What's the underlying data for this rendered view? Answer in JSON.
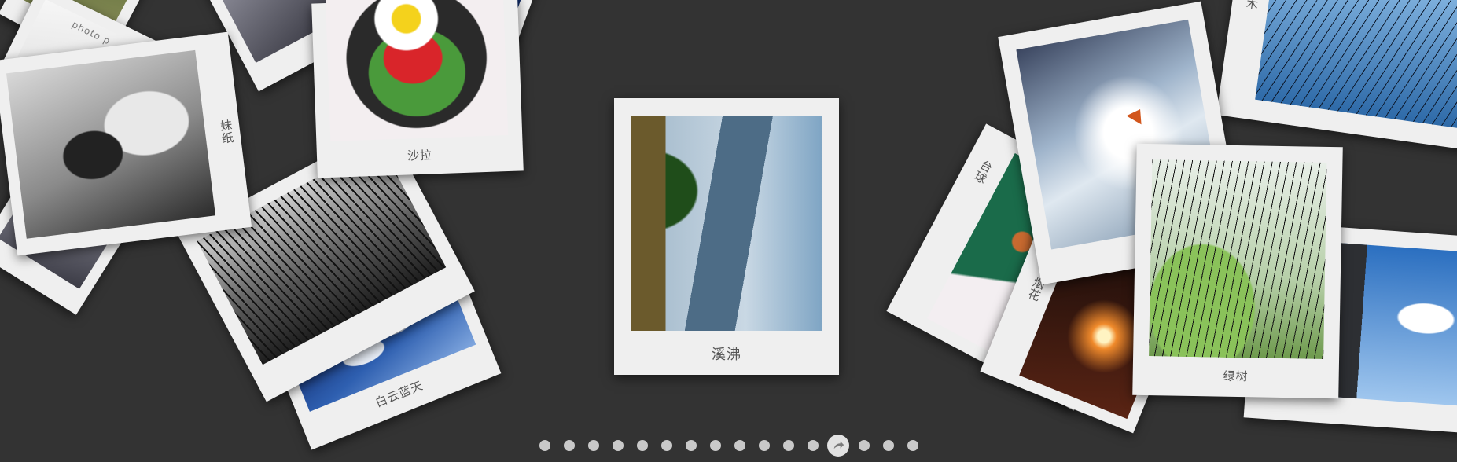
{
  "gallery": {
    "center_photo": {
      "caption": "溪沸"
    },
    "photos": [
      {
        "caption": "妹纸"
      },
      {
        "caption": "沙拉"
      },
      {
        "caption": "白云蓝天"
      },
      {
        "caption": "台球"
      },
      {
        "caption": "烟花"
      },
      {
        "caption": "绿树"
      },
      {
        "caption": "树木"
      },
      {
        "caption": "photo p"
      }
    ]
  },
  "pager": {
    "page_count": 16,
    "current_page": 13,
    "active_icon": "share-arrow-icon"
  },
  "colors": {
    "background": "#333333",
    "card": "#efefef",
    "dot": "#c9c9c9"
  }
}
